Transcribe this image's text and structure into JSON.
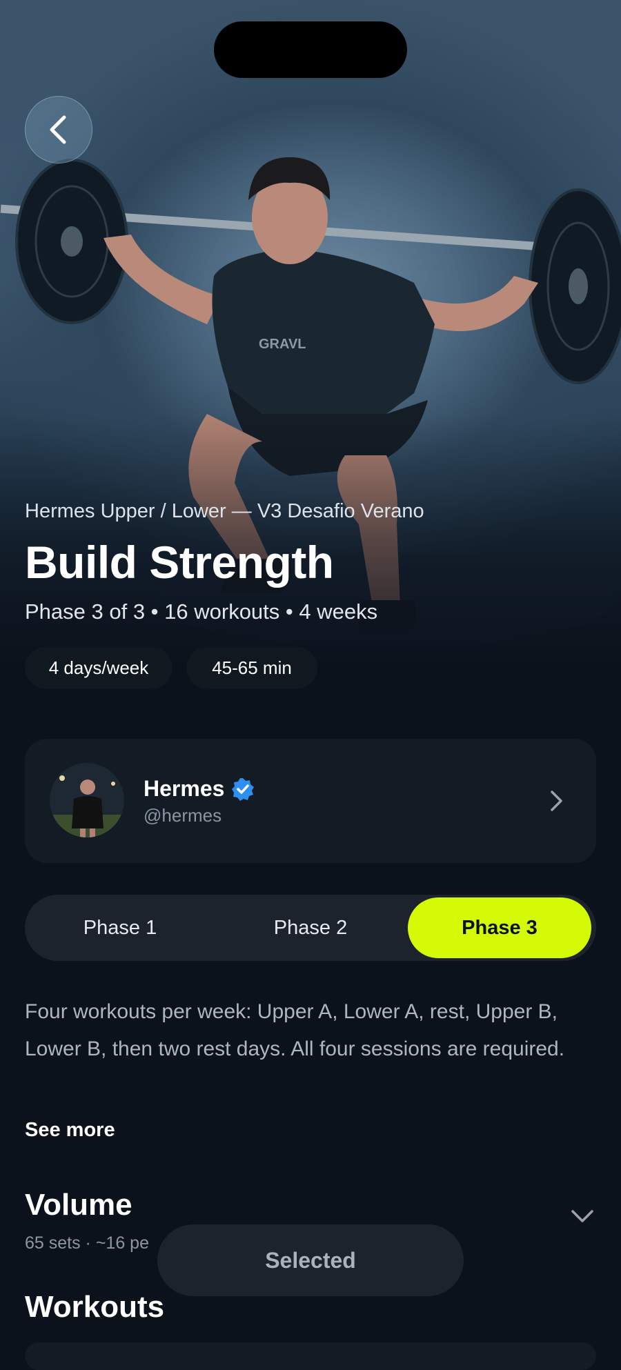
{
  "program": {
    "series": "Hermes Upper / Lower — V3 Desafio Verano",
    "title": "Build Strength",
    "meta": "Phase 3 of 3 • 16 workouts • 4 weeks",
    "chips": [
      "4 days/week",
      "45-65 min"
    ]
  },
  "hero_shirt_text": "GRAVL",
  "creator": {
    "name": "Hermes",
    "handle": "@hermes"
  },
  "phases": {
    "items": [
      "Phase 1",
      "Phase 2",
      "Phase 3"
    ],
    "selected": "Phase 3"
  },
  "description": "Four workouts per week: Upper A, Lower A, rest, Upper B, Lower B, then two rest days. All four sessions are required.",
  "see_more": "See more",
  "volume": {
    "title": "Volume",
    "subtitle": "65 sets · ~16 pe"
  },
  "selected_label": "Selected",
  "workouts_title": "Workouts",
  "colors": {
    "accent": "#d4fb05",
    "background": "#0b121c",
    "card": "#131b25",
    "verified": "#2d8ff0"
  },
  "icons": {
    "back": "chevron-left-icon",
    "verified": "verified-badge-icon",
    "creator_link": "chevron-right-icon",
    "volume_toggle": "chevron-down-icon"
  }
}
